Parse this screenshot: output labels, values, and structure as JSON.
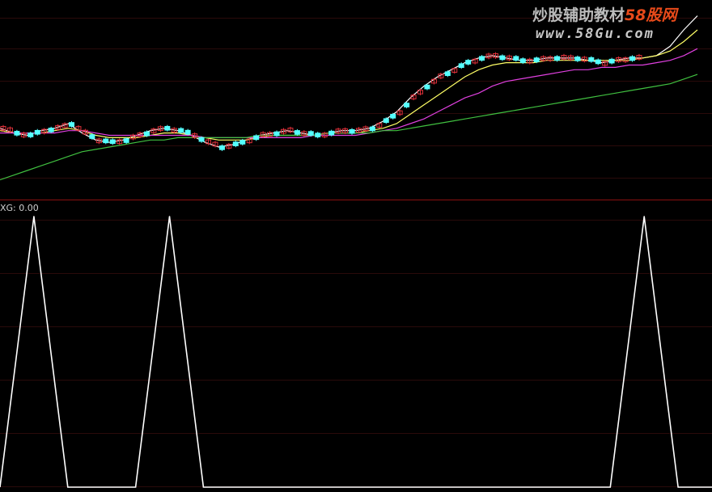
{
  "watermark": {
    "title_main": "炒股辅助教材",
    "title_accent": "58股网",
    "url": "www.58Gu.com"
  },
  "indicator": {
    "label": "XG: 0.00"
  },
  "colors": {
    "background": "#000000",
    "up_candle": "#e0303a",
    "down_candle": "#54ffff",
    "ma5": "#ffffff",
    "ma10": "#ffff66",
    "ma20": "#e040e0",
    "ma60": "#40c040",
    "xg_line": "#ffffff",
    "divider": "#8a1010",
    "grid": "#2a0a0a"
  },
  "chart_data": [
    {
      "type": "line",
      "title": "",
      "series": [
        {
          "values": [
            1.0,
            0.98,
            0.97,
            0.99,
            1.0,
            1.02,
            0.98,
            0.95,
            0.94,
            0.95,
            0.97,
            0.99,
            1.0,
            0.99,
            0.97,
            0.94,
            0.92,
            0.93,
            0.95,
            0.97,
            0.98,
            0.99,
            0.98,
            0.97,
            0.98,
            0.99,
            0.99,
            1.0,
            1.03,
            1.07,
            1.13,
            1.18,
            1.22,
            1.25,
            1.28,
            1.3,
            1.31,
            1.3,
            1.29,
            1.29,
            1.3,
            1.3,
            1.3,
            1.29,
            1.28,
            1.29,
            1.3,
            1.3,
            1.31,
            1.35,
            1.42,
            1.48
          ]
        },
        {
          "values": [
            0.99,
            0.98,
            0.98,
            0.98,
            0.99,
            1.0,
            0.99,
            0.97,
            0.96,
            0.96,
            0.96,
            0.97,
            0.98,
            0.98,
            0.97,
            0.96,
            0.95,
            0.95,
            0.95,
            0.96,
            0.97,
            0.97,
            0.97,
            0.97,
            0.98,
            0.98,
            0.98,
            0.99,
            1.0,
            1.02,
            1.06,
            1.1,
            1.14,
            1.18,
            1.22,
            1.25,
            1.27,
            1.28,
            1.28,
            1.28,
            1.29,
            1.29,
            1.29,
            1.29,
            1.29,
            1.29,
            1.29,
            1.3,
            1.31,
            1.33,
            1.37,
            1.42
          ]
        },
        {
          "values": [
            0.98,
            0.98,
            0.98,
            0.98,
            0.98,
            0.99,
            0.99,
            0.98,
            0.97,
            0.97,
            0.97,
            0.97,
            0.97,
            0.97,
            0.97,
            0.96,
            0.96,
            0.96,
            0.96,
            0.96,
            0.96,
            0.96,
            0.96,
            0.97,
            0.97,
            0.97,
            0.97,
            0.98,
            0.99,
            1.0,
            1.02,
            1.04,
            1.07,
            1.1,
            1.13,
            1.15,
            1.18,
            1.2,
            1.21,
            1.22,
            1.23,
            1.24,
            1.25,
            1.25,
            1.26,
            1.26,
            1.27,
            1.27,
            1.28,
            1.29,
            1.31,
            1.34
          ]
        },
        {
          "values": [
            0.78,
            0.8,
            0.82,
            0.84,
            0.86,
            0.88,
            0.9,
            0.91,
            0.92,
            0.93,
            0.94,
            0.95,
            0.95,
            0.96,
            0.96,
            0.96,
            0.96,
            0.96,
            0.96,
            0.97,
            0.97,
            0.97,
            0.97,
            0.97,
            0.98,
            0.98,
            0.98,
            0.98,
            0.99,
            0.99,
            1.0,
            1.01,
            1.02,
            1.03,
            1.04,
            1.05,
            1.06,
            1.07,
            1.08,
            1.09,
            1.1,
            1.11,
            1.12,
            1.13,
            1.14,
            1.15,
            1.16,
            1.17,
            1.18,
            1.19,
            1.21,
            1.23
          ]
        }
      ]
    },
    {
      "type": "line",
      "title": "XG",
      "series": [
        {
          "name": "XG",
          "values": [
            0,
            1,
            0,
            0,
            0,
            1,
            0,
            0,
            0,
            0,
            0,
            0,
            0,
            0,
            0,
            0,
            0,
            0,
            0,
            1,
            0,
            0
          ]
        }
      ],
      "ylim": [
        0,
        1
      ]
    }
  ]
}
